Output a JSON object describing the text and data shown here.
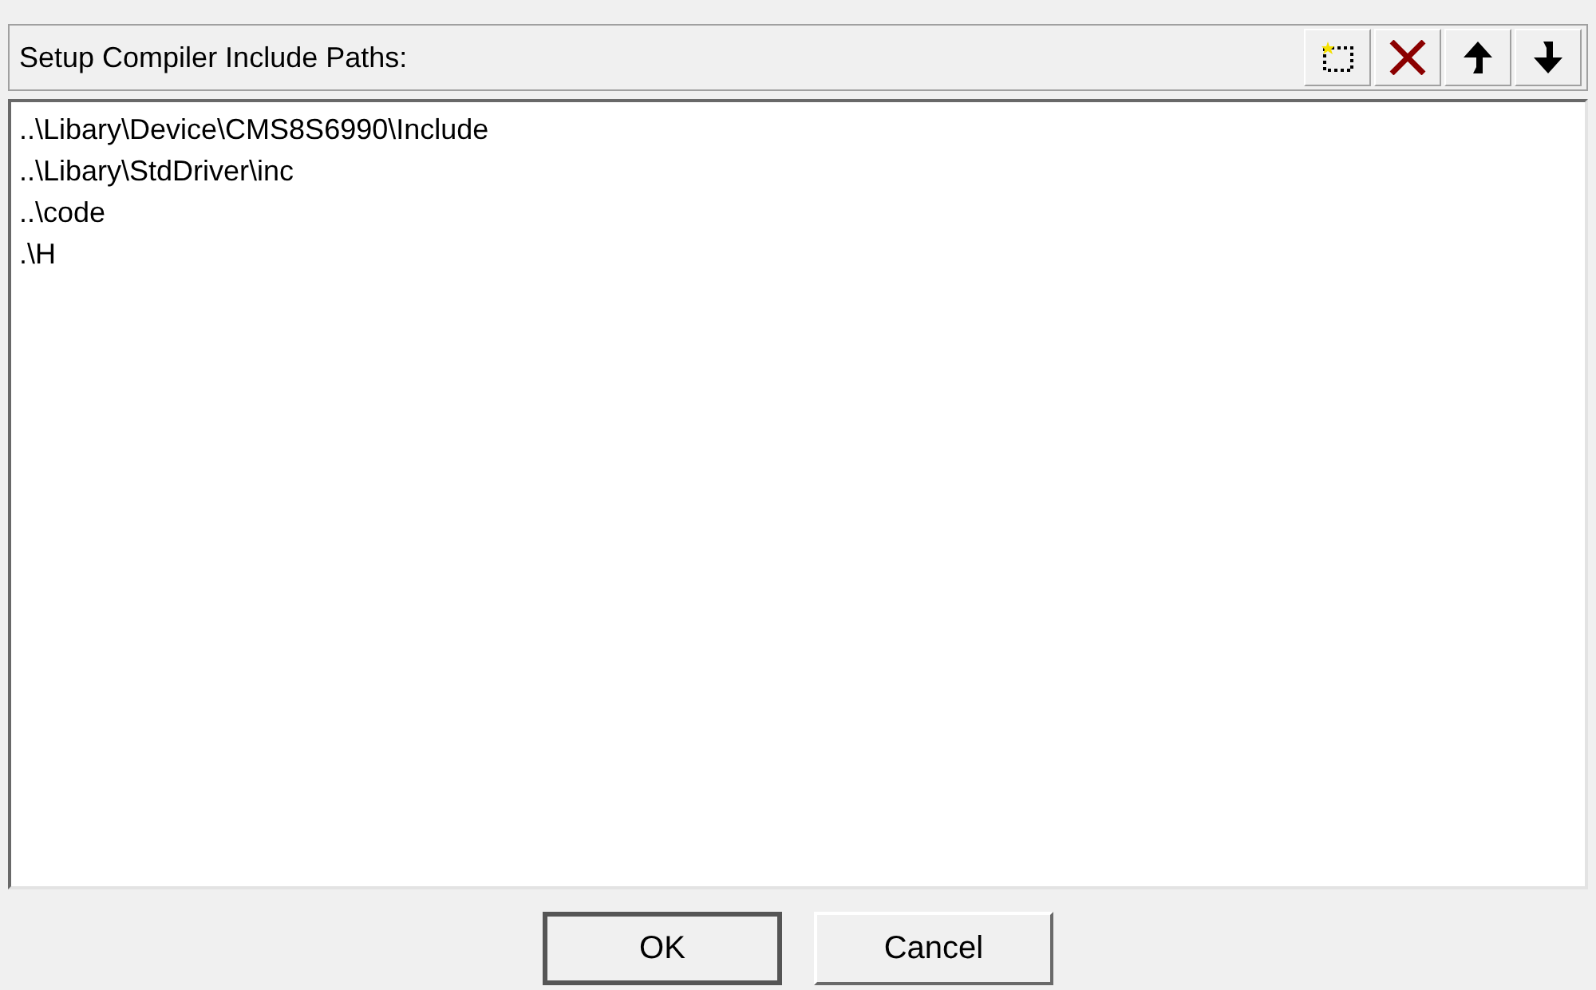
{
  "header": {
    "label": "Setup Compiler Include Paths:",
    "tools": [
      {
        "kind": "new"
      },
      {
        "kind": "delete"
      },
      {
        "kind": "up"
      },
      {
        "kind": "down"
      }
    ]
  },
  "paths": [
    {
      "text": "..\\Libary\\Device\\CMS8S6990\\Include"
    },
    {
      "text": "..\\Libary\\StdDriver\\inc"
    },
    {
      "text": "..\\code"
    },
    {
      "text": ".\\H"
    }
  ],
  "buttons": [
    {
      "label": "OK",
      "default": true
    },
    {
      "label": "Cancel",
      "default": false
    }
  ]
}
